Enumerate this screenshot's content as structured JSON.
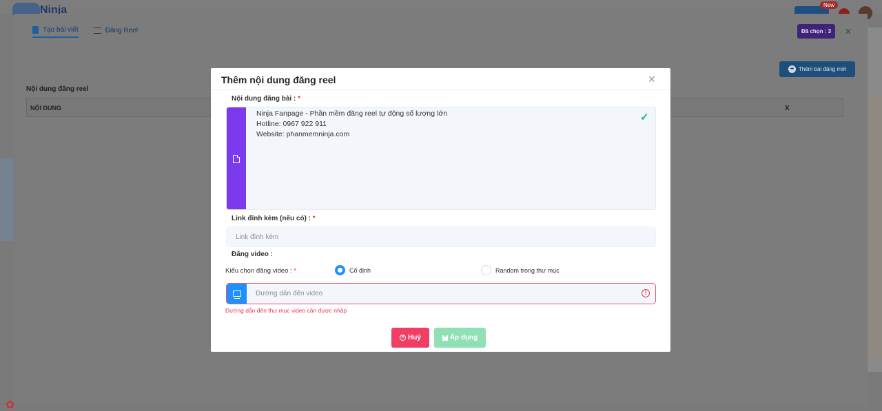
{
  "app": {
    "logo_text": "Ninja",
    "new_badge": "New"
  },
  "panel": {
    "tabs": [
      {
        "label": "Tạo bài viết",
        "active": true
      },
      {
        "label": "Đăng Reel",
        "active": false
      }
    ],
    "selected_label": "Đã chọn : 3",
    "add_button_label": "Thêm bài đăng mới",
    "heading": "Nội dung đăng reel",
    "table_headers": [
      "NỘI DUNG",
      "X"
    ]
  },
  "modal": {
    "title": "Thêm nội dung đăng reel",
    "content_label": "Nội dung đăng bài :",
    "content_lines": [
      "Ninja Fanpage - Phần mềm đăng reel tự động số lượng lớn",
      "Hotline: 0967 922 911",
      "Website: phanmemninja.com"
    ],
    "link_label": "Link đính kèm (nếu có) :",
    "link_placeholder": "Link đính kèm",
    "link_value": "",
    "video_section_label": "Đăng video :",
    "video_mode_label": "Kiểu chọn đăng video :",
    "video_mode_options": [
      {
        "label": "Cố định",
        "checked": true
      },
      {
        "label": "Random trong thư mục",
        "checked": false
      }
    ],
    "video_path_placeholder": "Đường dẫn đến video",
    "video_path_value": "",
    "video_path_error": "Đường dẫn đến thư mục video cần được nhập",
    "cancel_label": "Huỷ",
    "apply_label": "Áp dụng",
    "required_mark": "*"
  },
  "colors": {
    "accent_purple": "#7c3aed",
    "accent_blue": "#1e90ff",
    "error_red": "#e53950",
    "cancel_pink": "#f03e65",
    "apply_green": "#8fe0b4",
    "check_green": "#22b573"
  },
  "icons": {
    "content_side": "file-icon",
    "video_side": "monitor-icon",
    "valid": "check-icon",
    "invalid": "warning-icon"
  }
}
